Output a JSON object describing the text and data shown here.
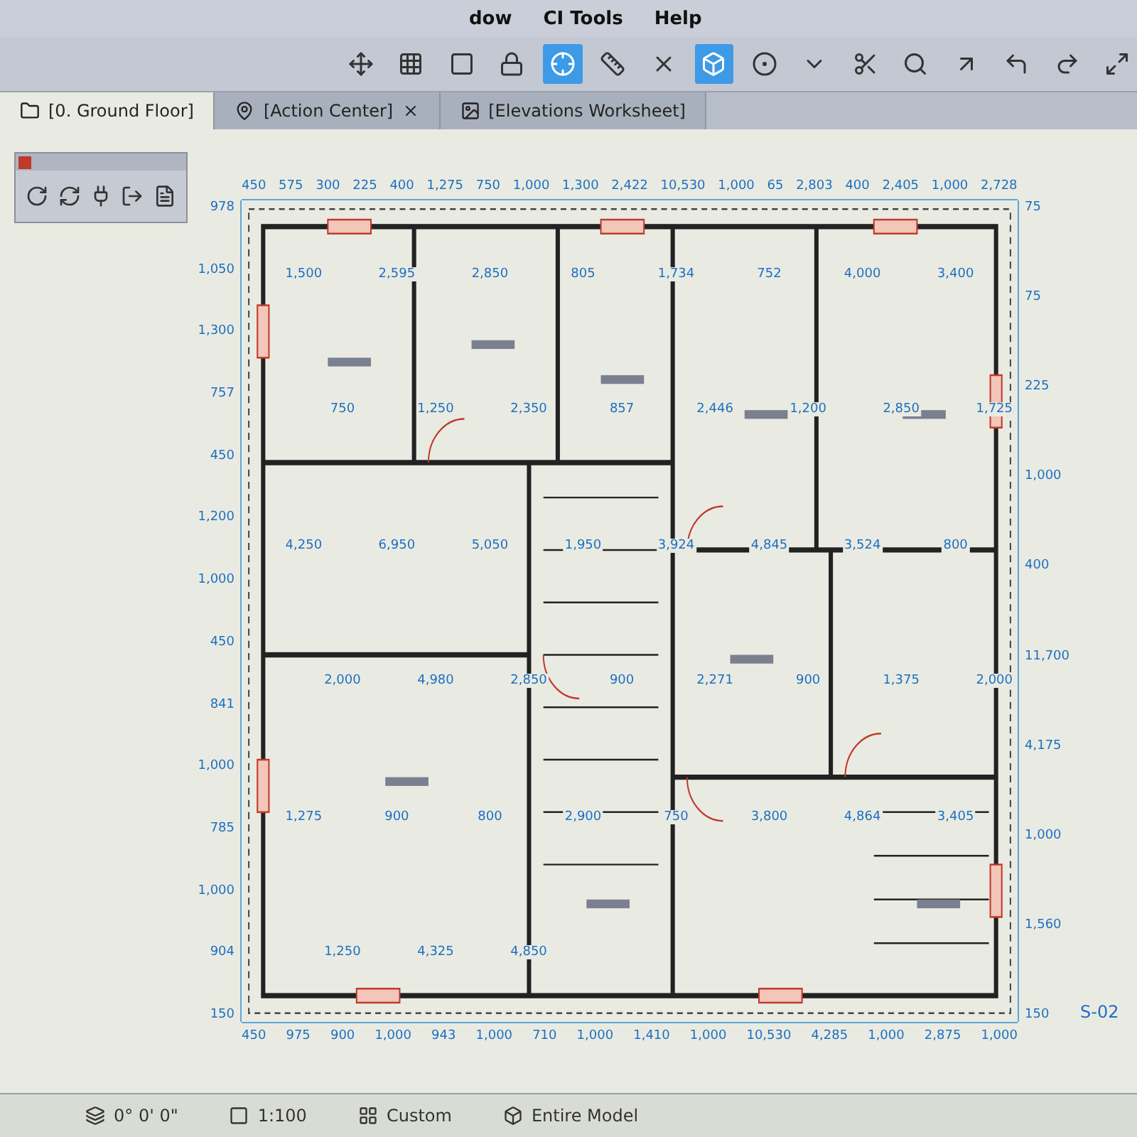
{
  "menu": [
    "dow",
    "CI Tools",
    "Help"
  ],
  "toolbar": [
    {
      "selected": false
    },
    {
      "selected": false
    },
    {
      "selected": false
    },
    {
      "selected": false
    },
    {
      "selected": true
    },
    {
      "selected": false
    },
    {
      "selected": false
    },
    {
      "selected": true
    },
    {
      "selected": false
    },
    {
      "selected": false
    },
    {
      "selected": false
    },
    {
      "selected": false
    },
    {
      "selected": false
    },
    {
      "selected": false
    },
    {
      "selected": false
    },
    {
      "selected": false
    }
  ],
  "tabs": [
    {
      "label": "[0. Ground Floor]",
      "selected": true,
      "closable": false
    },
    {
      "label": "[Action Center]",
      "selected": false,
      "closable": true
    },
    {
      "label": "[Elevations Worksheet]",
      "selected": false,
      "closable": false
    }
  ],
  "plan": {
    "top_dimensions": [
      "450",
      "575",
      "300",
      "225",
      "400",
      "1,275",
      "750",
      "1,000",
      "1,300",
      "2,422",
      "10,530",
      "1,000",
      "65",
      "2,803",
      "400",
      "2,405",
      "1,000",
      "2,728"
    ],
    "left_dimensions": [
      "978",
      "1,050",
      "1,300",
      "757",
      "450",
      "1,200",
      "1,000",
      "450",
      "841",
      "1,000",
      "785",
      "1,000",
      "904",
      "150"
    ],
    "room_dimensions": [
      "1,500",
      "2,595",
      "2,850",
      "805",
      "1,734",
      "752",
      "4,000",
      "3,400",
      "750",
      "1,250",
      "2,350",
      "857",
      "2,446",
      "1,200",
      "2,850",
      "1,725",
      "4,250",
      "6,950",
      "5,050",
      "1,950",
      "3,924",
      "4,845",
      "3,524",
      "800",
      "2,000",
      "4,980",
      "2,850",
      "900",
      "2,271",
      "900",
      "1,375",
      "2,000",
      "1,275",
      "900",
      "800",
      "2,900",
      "750",
      "3,800",
      "4,864",
      "3,405",
      "1,250",
      "4,325",
      "4,850"
    ],
    "bottom_dimensions": [
      "450",
      "975",
      "900",
      "1,000",
      "943",
      "1,000",
      "710",
      "1,000",
      "1,410",
      "1,000",
      "10,530",
      "4,285",
      "1,000",
      "2,875",
      "1,000"
    ],
    "right_dimensions": [
      "75",
      "75",
      "225",
      "1,000",
      "400",
      "11,700",
      "4,175",
      "1,000",
      "1,560",
      "150"
    ],
    "section_marker": "S-02"
  },
  "status_bar": [
    "0° 0' 0\"",
    "1:100",
    "Custom",
    "Entire Model"
  ]
}
